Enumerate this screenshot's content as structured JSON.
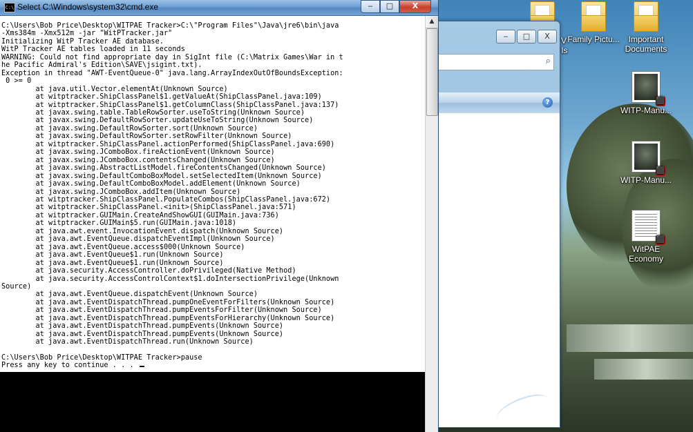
{
  "cmd_window": {
    "title": "Select C:\\Windows\\system32\\cmd.exe",
    "buttons": {
      "minimize": "‒",
      "maximize": "□",
      "close": "X"
    },
    "lines": [
      "C:\\Users\\Bob Price\\Desktop\\WITPAE Tracker>C:\\\"Program Files\"\\Java\\jre6\\bin\\java",
      "-Xms384m -Xmx512m -jar \"WitPTracker.jar\"",
      "Initializing WitP Tracker AE database.",
      "WitP Tracker AE tables loaded in 11 seconds",
      "WARNING: Could not find appropriate day in SigInt file (C:\\Matrix Games\\War in t",
      "he Pacific Admiral's Edition\\SAVE\\jsigint.txt).",
      "Exception in thread \"AWT-EventQueue-0\" java.lang.ArrayIndexOutOfBoundsException:",
      " 0 >= 0",
      "        at java.util.Vector.elementAt(Unknown Source)",
      "        at witptracker.ShipClassPanel$1.getValueAt(ShipClassPanel.java:109)",
      "        at witptracker.ShipClassPanel$1.getColumnClass(ShipClassPanel.java:137)",
      "        at javax.swing.table.TableRowSorter.useToString(Unknown Source)",
      "        at javax.swing.DefaultRowSorter.updateUseToString(Unknown Source)",
      "        at javax.swing.DefaultRowSorter.sort(Unknown Source)",
      "        at javax.swing.DefaultRowSorter.setRowFilter(Unknown Source)",
      "        at witptracker.ShipClassPanel.actionPerformed(ShipClassPanel.java:690)",
      "        at javax.swing.JComboBox.fireActionEvent(Unknown Source)",
      "        at javax.swing.JComboBox.contentsChanged(Unknown Source)",
      "        at javax.swing.AbstractListModel.fireContentsChanged(Unknown Source)",
      "        at javax.swing.DefaultComboBoxModel.setSelectedItem(Unknown Source)",
      "        at javax.swing.DefaultComboBoxModel.addElement(Unknown Source)",
      "        at javax.swing.JComboBox.addItem(Unknown Source)",
      "        at witptracker.ShipClassPanel.PopulateCombos(ShipClassPanel.java:672)",
      "        at witptracker.ShipClassPanel.<init>(ShipClassPanel.java:571)",
      "        at witptracker.GUIMain.CreateAndShowGUI(GUIMain.java:736)",
      "        at witptracker.GUIMain$5.run(GUIMain.java:1018)",
      "        at java.awt.event.InvocationEvent.dispatch(Unknown Source)",
      "        at java.awt.EventQueue.dispatchEventImpl(Unknown Source)",
      "        at java.awt.EventQueue.access$000(Unknown Source)",
      "        at java.awt.EventQueue$1.run(Unknown Source)",
      "        at java.awt.EventQueue$1.run(Unknown Source)",
      "        at java.security.AccessController.doPrivileged(Native Method)",
      "        at java.security.AccessControlContext$1.doIntersectionPrivilege(Unknown",
      "Source)",
      "        at java.awt.EventQueue.dispatchEvent(Unknown Source)",
      "        at java.awt.EventDispatchThread.pumpOneEventForFilters(Unknown Source)",
      "        at java.awt.EventDispatchThread.pumpEventsForFilter(Unknown Source)",
      "        at java.awt.EventDispatchThread.pumpEventsForHierarchy(Unknown Source)",
      "        at java.awt.EventDispatchThread.pumpEvents(Unknown Source)",
      "        at java.awt.EventDispatchThread.pumpEvents(Unknown Source)",
      "        at java.awt.EventDispatchThread.run(Unknown Source)",
      "",
      "C:\\Users\\Bob Price\\Desktop\\WITPAE Tracker>pause",
      "Press any key to continue . . . "
    ]
  },
  "explorer_window": {
    "buttons": {
      "minimize": "‒",
      "maximize": "□",
      "close": "X"
    },
    "help_label": "?",
    "search_icon": "⌕"
  },
  "desktop": {
    "partial_labels": {
      "v_label": "V",
      "ls_label": "ls"
    },
    "icons": [
      {
        "label": "Family Pictu...",
        "type": "folder"
      },
      {
        "label": "Important Documents",
        "type": "folder"
      },
      {
        "label": "WITP-Manu...",
        "type": "pdf"
      },
      {
        "label": "WITP-Manu...",
        "type": "pdf"
      },
      {
        "label": "WitPAE Economy",
        "type": "pdf"
      }
    ]
  }
}
